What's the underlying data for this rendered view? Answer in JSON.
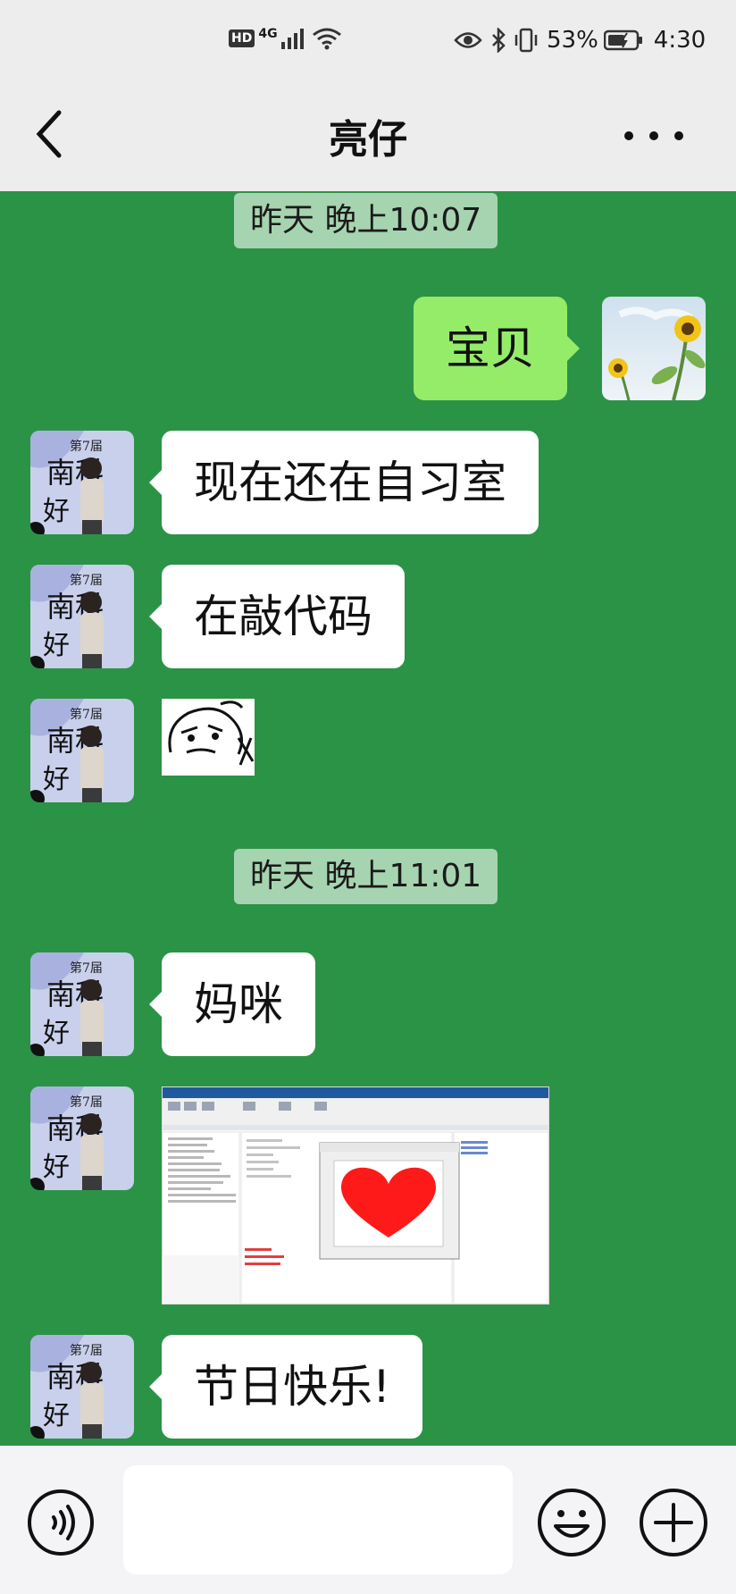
{
  "status_bar": {
    "network_badge": "HD",
    "network_type": "4G",
    "battery_percent": "53%",
    "time": "4:30",
    "icons": [
      "signal-icon",
      "wifi-icon",
      "eye-icon",
      "bluetooth-icon",
      "vibrate-icon",
      "battery-icon"
    ]
  },
  "header": {
    "title": "亮仔",
    "back_icon": "chevron-left-icon",
    "more_icon": "more-dots-icon"
  },
  "messages": [
    {
      "type": "timestamp",
      "text": "昨天 晚上10:07"
    },
    {
      "type": "text",
      "sender": "me",
      "text": "宝贝"
    },
    {
      "type": "text",
      "sender": "contact",
      "text": "现在还在自习室"
    },
    {
      "type": "text",
      "sender": "contact",
      "text": "在敲代码"
    },
    {
      "type": "sticker",
      "sender": "contact"
    },
    {
      "type": "timestamp",
      "text": "昨天 晚上11:01"
    },
    {
      "type": "text",
      "sender": "contact",
      "text": "妈咪"
    },
    {
      "type": "image",
      "sender": "contact",
      "description_icon": "matlab-screenshot-heart-plot"
    },
    {
      "type": "text",
      "sender": "contact",
      "text": "节日快乐!"
    }
  ],
  "avatar": {
    "contact_text": [
      "第7届",
      "南科",
      "好"
    ]
  },
  "input_bar": {
    "placeholder": "",
    "icons": [
      "voice-icon",
      "emoji-icon",
      "plus-icon"
    ]
  },
  "colors": {
    "chat_background": "#2b9346",
    "my_bubble": "#95ec69",
    "their_bubble": "#ffffff",
    "timestamp_bg": "#a6d4b0",
    "header_bg": "#ededed"
  }
}
